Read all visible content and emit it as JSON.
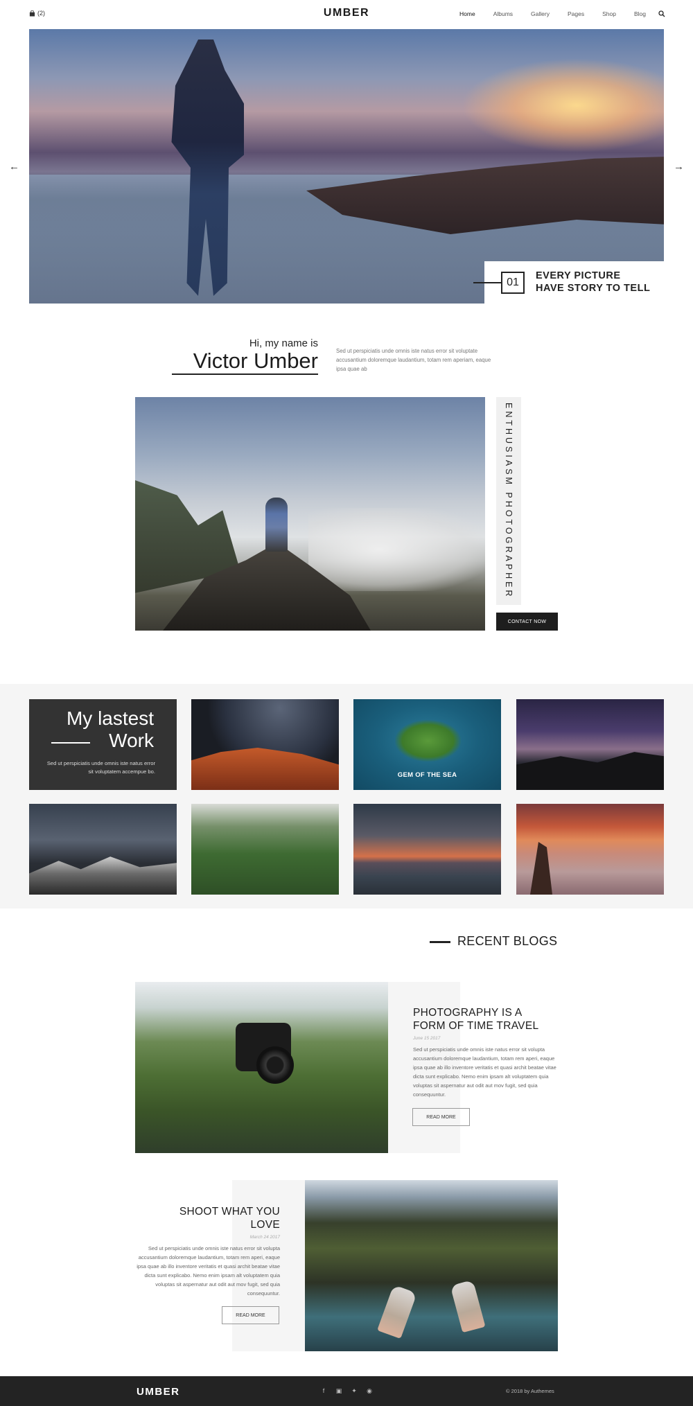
{
  "header": {
    "cart_count": "(2)",
    "logo": "UMBER",
    "nav": [
      "Home",
      "Albums",
      "Gallery",
      "Pages",
      "Shop",
      "Blog"
    ],
    "active_nav": "Home"
  },
  "hero": {
    "slide_number": "01",
    "caption_line1": "EVERY PICTURE",
    "caption_line2": "HAVE STORY TO TELL"
  },
  "about": {
    "greeting": "Hi, my name is",
    "name": "Victor Umber",
    "description": "Sed ut perspiciatis unde omnis iste natus error sit voluptate accusantium doloremque laudantium, totam rem aperiam, eaque ipsa quae ab",
    "vertical_label": "ENTHUSIASM PHOTOGRAPHER",
    "contact_button": "CONTACT NOW"
  },
  "gallery": {
    "title_line1": "My lastest",
    "title_line2": "Work",
    "description": "Sed ut perspiciatis unde omnis iste natus error sit voluptatem accempue bo.",
    "featured_label": "GEM OF THE SEA"
  },
  "blogs": {
    "section_title": "RECENT BLOGS",
    "posts": [
      {
        "title_line1": "PHOTOGRAPHY IS A",
        "title_line2": "FORM OF TIME TRAVEL",
        "date": "June 15 2017",
        "body": "Sed ut perspiciatis unde omnis iste natus error sit volupta accusantium doloremque laudantium, totam rem aperi, eaque ipsa quae ab illo inventore veritatis et quasi archit beatae vitae dicta sunt explicabo. Nemo enim ipsam alt voluptatem quia voluptas sit aspernatur aut odit aut mov fugit, sed quia consequuntur.",
        "button": "READ MORE"
      },
      {
        "title_line1": "SHOOT WHAT YOU",
        "title_line2": "LOVE",
        "date": "March 24 2017",
        "body": "Sed ut perspiciatis unde omnis iste natus error sit volupta accusantium doloremque laudantium, totam rem aperi, eaque ipsa quae ab illo inventore veritatis et quasi archit beatae vitae dicta sunt explicabo. Nemo enim ipsam alt voluptatem quia voluptas sit aspernatur aut odit aut mov fugit, sed quia consequuntur.",
        "button": "READ MORE"
      }
    ]
  },
  "footer": {
    "logo": "UMBER",
    "social_icons": [
      "facebook-icon",
      "instagram-icon",
      "twitter-icon",
      "pinterest-icon"
    ],
    "copyright": "© 2018 by Authemes"
  },
  "colors": {
    "dark": "#232323",
    "panel": "#333333",
    "light_bg": "#f5f5f5"
  }
}
